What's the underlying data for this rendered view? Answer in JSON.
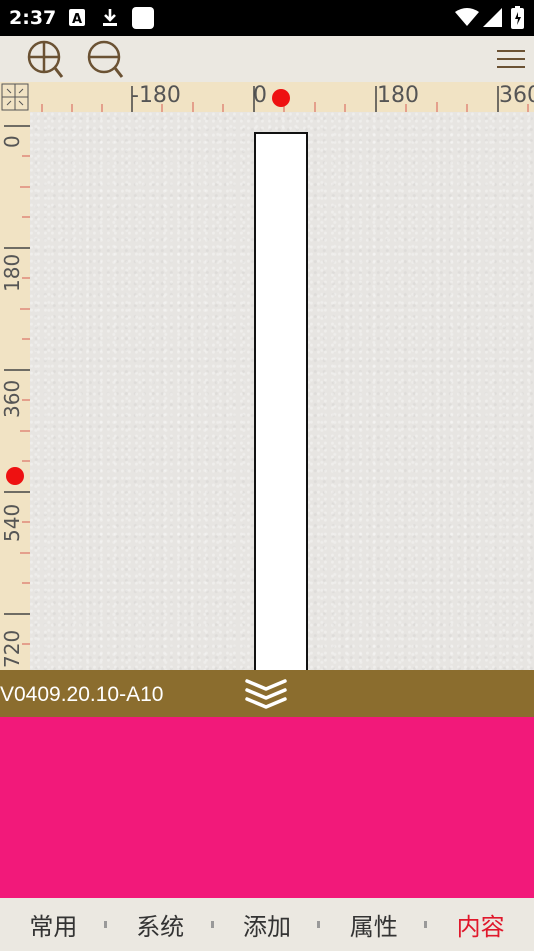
{
  "status_bar": {
    "time": "2:37",
    "left_icons": [
      "a-notification-icon",
      "download-icon",
      "square-app-icon"
    ],
    "right_icons": [
      "wifi-icon",
      "signal-icon",
      "battery-icon"
    ]
  },
  "toolbar": {
    "zoom_in": "zoom-in-icon",
    "zoom_out": "zoom-out-icon",
    "menu": "menu-icon"
  },
  "ruler": {
    "h_labels": [
      "-180",
      "0",
      "180",
      "360"
    ],
    "v_labels": [
      "0",
      "180",
      "360",
      "540",
      "720"
    ]
  },
  "info_bar": {
    "version": "V0409.20.10-A10",
    "layers_icon": "layers-icon"
  },
  "bottom_nav": {
    "items": [
      {
        "label": "常用"
      },
      {
        "label": "系统"
      },
      {
        "label": "添加"
      },
      {
        "label": "属性"
      },
      {
        "label": "内容"
      }
    ],
    "active_index": 4
  },
  "colors": {
    "status_bar": "#000000",
    "toolbar": "#ebe8e1",
    "ruler": "#f1e3c4",
    "info_bar": "#8b6d2e",
    "panel": "#f2197a",
    "active_nav": "#e0182c",
    "origin_marker": "#ee1111"
  }
}
